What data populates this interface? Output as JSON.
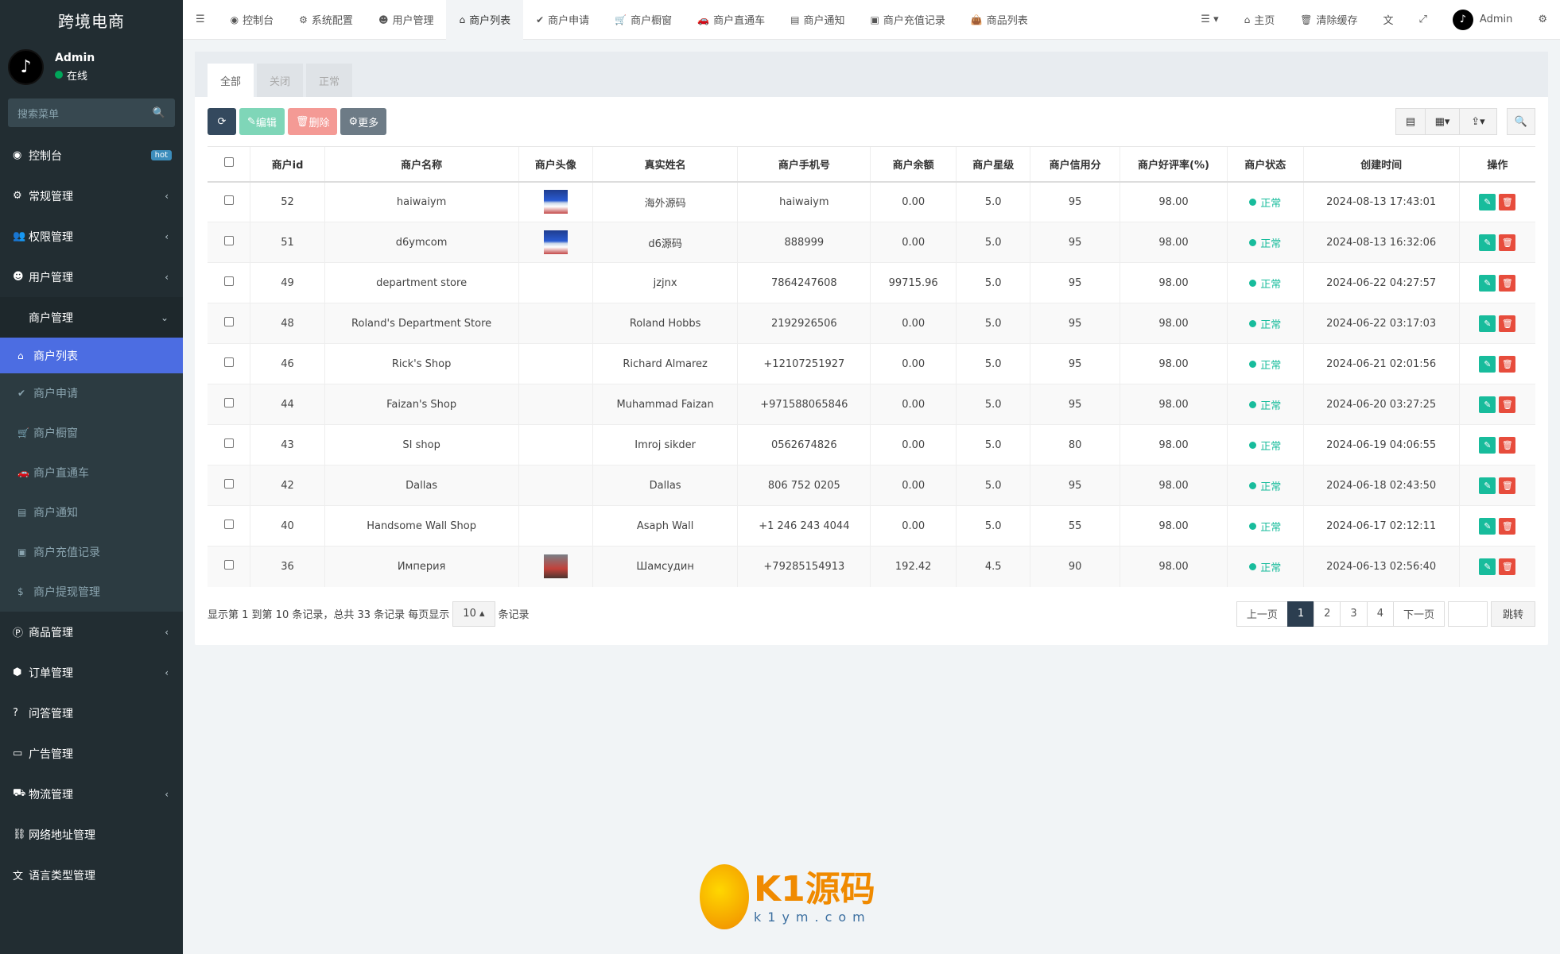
{
  "brand": "跨境电商",
  "user": {
    "name": "Admin",
    "status": "在线"
  },
  "sidebar": {
    "search_placeholder": "搜索菜单",
    "items": [
      {
        "label": "控制台",
        "badge": "hot",
        "icon": "dashboard-icon"
      },
      {
        "label": "常规管理",
        "icon": "cogs-icon"
      },
      {
        "label": "权限管理",
        "icon": "users-icon"
      },
      {
        "label": "用户管理",
        "icon": "user-circle-icon"
      },
      {
        "label": "商户管理",
        "icon": "apple-icon"
      }
    ],
    "submenu": [
      {
        "label": "商户列表",
        "icon": "home-icon"
      },
      {
        "label": "商户申请",
        "icon": "check-circle-icon"
      },
      {
        "label": "商户橱窗",
        "icon": "cart-icon"
      },
      {
        "label": "商户直通车",
        "icon": "car-icon"
      },
      {
        "label": "商户通知",
        "icon": "notice-icon"
      },
      {
        "label": "商户充值记录",
        "icon": "money-icon"
      },
      {
        "label": "商户提现管理",
        "icon": "dollar-icon"
      }
    ],
    "items_after": [
      {
        "label": "商品管理",
        "icon": "product-icon"
      },
      {
        "label": "订单管理",
        "icon": "cube-icon"
      },
      {
        "label": "问答管理",
        "icon": "question-icon"
      },
      {
        "label": "广告管理",
        "icon": "ad-icon"
      },
      {
        "label": "物流管理",
        "icon": "truck-icon"
      },
      {
        "label": "网络地址管理",
        "icon": "link-icon"
      },
      {
        "label": "语言类型管理",
        "icon": "language-icon"
      }
    ]
  },
  "topnav": {
    "tabs": [
      "控制台",
      "系统配置",
      "用户管理",
      "商户列表",
      "商户申请",
      "商户橱窗",
      "商户直通车",
      "商户通知",
      "商户充值记录",
      "商品列表"
    ],
    "home": "主页",
    "clear_cache": "清除缓存",
    "user": "Admin"
  },
  "filter_tabs": [
    "全部",
    "关闭",
    "正常"
  ],
  "toolbar": {
    "edit": "编辑",
    "delete": "删除",
    "more": "更多"
  },
  "table": {
    "headers": [
      "商户id",
      "商户名称",
      "商户头像",
      "真实姓名",
      "商户手机号",
      "商户余额",
      "商户星级",
      "商户信用分",
      "商户好评率(%)",
      "商户状态",
      "创建时间",
      "操作"
    ],
    "rows": [
      {
        "id": "52",
        "name": "haiwaiym",
        "avatar": "blue",
        "real_name": "海外源码",
        "phone": "haiwaiym",
        "balance": "0.00",
        "stars": "5.0",
        "credit": "95",
        "rating": "98.00",
        "status": "正常",
        "created": "2024-08-13 17:43:01"
      },
      {
        "id": "51",
        "name": "d6ymcom",
        "avatar": "blue",
        "real_name": "d6源码",
        "phone": "888999",
        "balance": "0.00",
        "stars": "5.0",
        "credit": "95",
        "rating": "98.00",
        "status": "正常",
        "created": "2024-08-13 16:32:06"
      },
      {
        "id": "49",
        "name": "department store",
        "avatar": "",
        "real_name": "jzjnx",
        "phone": "7864247608",
        "balance": "99715.96",
        "stars": "5.0",
        "credit": "95",
        "rating": "98.00",
        "status": "正常",
        "created": "2024-06-22 04:27:57"
      },
      {
        "id": "48",
        "name": "Roland's Department Store",
        "avatar": "",
        "real_name": "Roland Hobbs",
        "phone": "2192926506",
        "balance": "0.00",
        "stars": "5.0",
        "credit": "95",
        "rating": "98.00",
        "status": "正常",
        "created": "2024-06-22 03:17:03"
      },
      {
        "id": "46",
        "name": "Rick's Shop",
        "avatar": "",
        "real_name": "Richard Almarez",
        "phone": "+12107251927",
        "balance": "0.00",
        "stars": "5.0",
        "credit": "95",
        "rating": "98.00",
        "status": "正常",
        "created": "2024-06-21 02:01:56"
      },
      {
        "id": "44",
        "name": "Faizan's Shop",
        "avatar": "",
        "real_name": "Muhammad Faizan",
        "phone": "+971588065846",
        "balance": "0.00",
        "stars": "5.0",
        "credit": "95",
        "rating": "98.00",
        "status": "正常",
        "created": "2024-06-20 03:27:25"
      },
      {
        "id": "43",
        "name": "SI shop",
        "avatar": "",
        "real_name": "Imroj sikder",
        "phone": "0562674826",
        "balance": "0.00",
        "stars": "5.0",
        "credit": "80",
        "rating": "98.00",
        "status": "正常",
        "created": "2024-06-19 04:06:55"
      },
      {
        "id": "42",
        "name": "Dallas",
        "avatar": "",
        "real_name": "Dallas",
        "phone": "806 752 0205",
        "balance": "0.00",
        "stars": "5.0",
        "credit": "95",
        "rating": "98.00",
        "status": "正常",
        "created": "2024-06-18 02:43:50"
      },
      {
        "id": "40",
        "name": "Handsome Wall Shop",
        "avatar": "",
        "real_name": "Asaph Wall",
        "phone": "+1 246 243 4044",
        "balance": "0.00",
        "stars": "5.0",
        "credit": "55",
        "rating": "98.00",
        "status": "正常",
        "created": "2024-06-17 02:12:11"
      },
      {
        "id": "36",
        "name": "Империя",
        "avatar": "red",
        "real_name": "Шамсудин",
        "phone": "+79285154913",
        "balance": "192.42",
        "stars": "4.5",
        "credit": "90",
        "rating": "98.00",
        "status": "正常",
        "created": "2024-06-13 02:56:40"
      }
    ]
  },
  "pager": {
    "summary_prefix": "显示第 1 到第 10 条记录，总共 33 条记录 每页显示",
    "page_size": "10",
    "summary_suffix": "条记录",
    "prev": "上一页",
    "pages": [
      "1",
      "2",
      "3",
      "4"
    ],
    "active_page": "1",
    "next": "下一页",
    "jump": "跳转"
  },
  "watermark": {
    "logo": "K1源码",
    "url": "k1ym.com"
  },
  "colors": {
    "sidebar": "#222d32",
    "active_menu": "#4c6de2",
    "status_ok": "#18bc9c",
    "delete": "#e74c3c"
  }
}
